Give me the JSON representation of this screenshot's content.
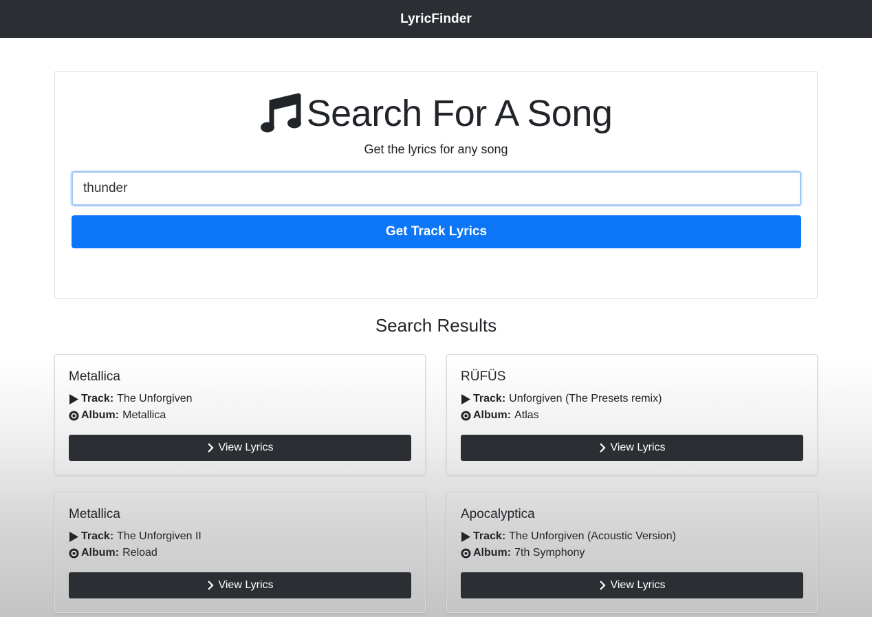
{
  "navbar": {
    "brand": "LyricFinder"
  },
  "search": {
    "icon": "music-note-icon",
    "title": "Search For A Song",
    "subtitle": "Get the lyrics for any song",
    "input_value": "thunder",
    "button_label": "Get Track Lyrics",
    "accent_color": "#0d76f7"
  },
  "results": {
    "heading": "Search Results",
    "track_label": "Track:",
    "album_label": "Album:",
    "view_label": "View Lyrics",
    "items": [
      {
        "artist": "Metallica",
        "track": "The Unforgiven",
        "album": "Metallica"
      },
      {
        "artist": "RÜFÜS",
        "track": "Unforgiven (The Presets remix)",
        "album": "Atlas"
      },
      {
        "artist": "Metallica",
        "track": "The Unforgiven II",
        "album": "Reload"
      },
      {
        "artist": "Apocalyptica",
        "track": "The Unforgiven (Acoustic Version)",
        "album": "7th Symphony"
      }
    ]
  }
}
